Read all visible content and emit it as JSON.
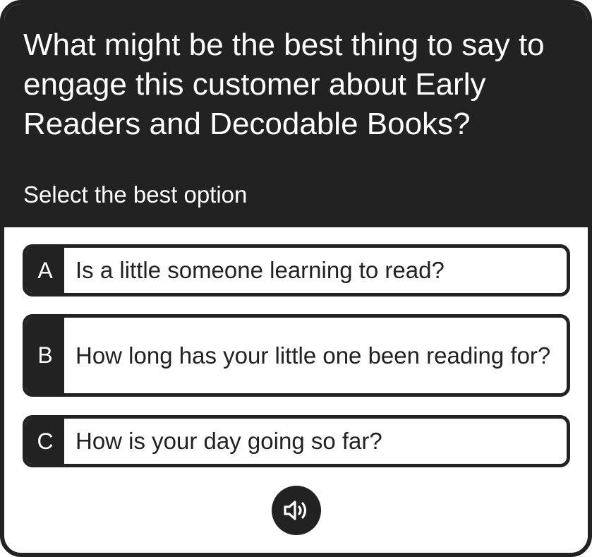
{
  "question": {
    "text": "What might be the best thing to say to engage this customer about Early Readers and Decodable Books?",
    "instruction": "Select the best option"
  },
  "options": [
    {
      "letter": "A",
      "text": "Is a little someone learning to read?"
    },
    {
      "letter": "B",
      "text": "How long has your little one been reading for?"
    },
    {
      "letter": "C",
      "text": "How is your day going so far?"
    }
  ],
  "audio_button": {
    "icon": "speaker-icon"
  },
  "colors": {
    "dark": "#222222",
    "light": "#ffffff"
  }
}
